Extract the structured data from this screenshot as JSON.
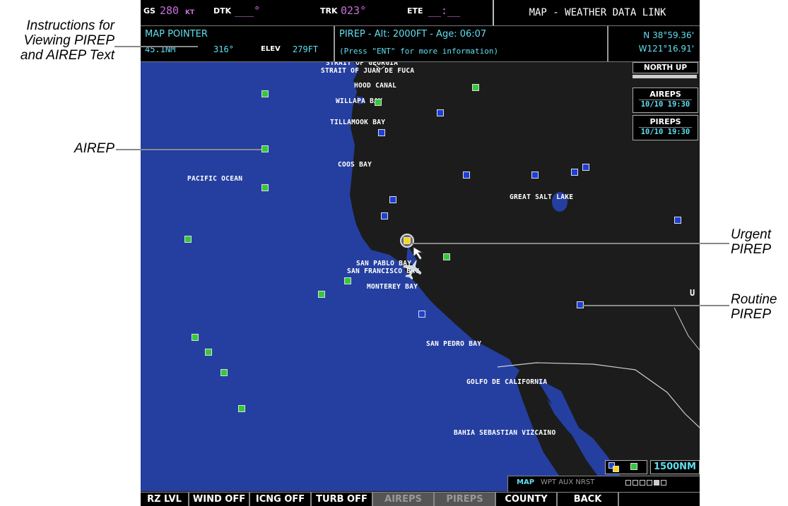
{
  "callouts": {
    "instructions": [
      "Instructions for",
      "Viewing PIREP",
      "and AIREP Text"
    ],
    "airep": "AIREP",
    "urgent": [
      "Urgent",
      "PIREP"
    ],
    "routine": [
      "Routine",
      "PIREP"
    ]
  },
  "navbar": {
    "gs_label": "GS",
    "gs_value": "280",
    "gs_unit": "KT",
    "dtk_label": "DTK",
    "dtk_value": "___°",
    "trk_label": "TRK",
    "trk_value": "023°",
    "ete_label": "ETE",
    "ete_value": "__:__",
    "page_title": "MAP - WEATHER DATA LINK"
  },
  "infobar": {
    "pointer_title": "MAP POINTER",
    "pointer_dist": "45.1NM",
    "pointer_brg": "316°",
    "elev_label": "ELEV",
    "elev_value": "279FT",
    "pirep_line1": "PIREP - Alt: 2000FT - Age: 06:07",
    "pirep_line2": "(Press \"ENT\" for more information)",
    "lat": "N 38°59.36'",
    "lon": "W121°16.91'"
  },
  "map_labels": {
    "strait_georgia": "STRAIT OF GEORGIA",
    "strait_fuca": "STRAIT OF JUAN DE FUCA",
    "hood_canal": "HOOD CANAL",
    "willapa": "WILLAPA BAY",
    "tillamook": "TILLAMOOK BAY",
    "coos": "COOS BAY",
    "pacific": "PACIFIC OCEAN",
    "salt_lake": "GREAT SALT LAKE",
    "san_pablo": "SAN PABLO BAY",
    "san_francisco": "SAN FRANCISCO BAY",
    "monterey": "MONTEREY BAY",
    "san_pedro": "SAN PEDRO BAY",
    "golfo": "GOLFO DE CALIFORNIA",
    "bahia": "BAHIA SEBASTIAN VIZCAINO",
    "edge_u": "U"
  },
  "panels": {
    "orientation": "NORTH UP",
    "aireps_label": "AIREPS",
    "aireps_time": "10/10 19:30",
    "pireps_label": "PIREPS",
    "pireps_time": "10/10 19:30",
    "range": "1500NM",
    "page_group": "MAP",
    "page_items": "WPT AUX NRST"
  },
  "softkeys": [
    "RZ LVL",
    "WIND OFF",
    "ICNG OFF",
    "TURB OFF",
    "AIREPS",
    "PIREPS",
    "COUNTY",
    "BACK"
  ],
  "colors": {
    "ocean": "#253fa0",
    "land": "#1c1c1c",
    "airep": "#34c93b",
    "pirep_routine": "#1c3fd8",
    "pirep_urgent": "#f3d81a",
    "accent_value": "#c86fd8",
    "info_cyan": "#5fe0f0"
  }
}
